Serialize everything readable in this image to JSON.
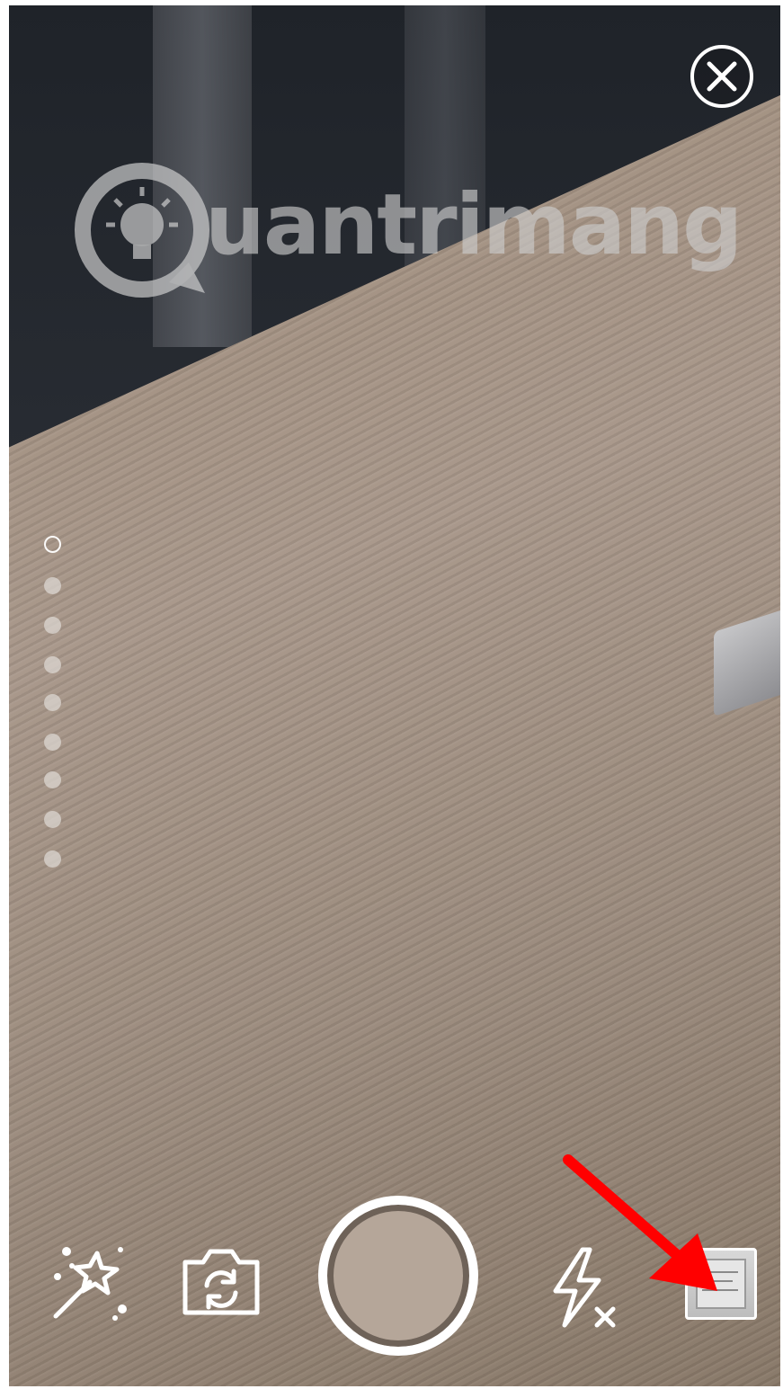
{
  "app": {
    "screen": "camera-capture"
  },
  "watermark": {
    "text": "uantrimang"
  },
  "zoom": {
    "levels": 9,
    "active_index": 0
  },
  "controls": {
    "effects_icon": "magic-wand-icon",
    "switch_camera_icon": "camera-switch-icon",
    "flash_icon": "flash-off-icon",
    "gallery_icon": "gallery-thumbnail-icon",
    "close_icon": "close-icon"
  },
  "annotation": {
    "arrow_color": "#ff0000"
  }
}
